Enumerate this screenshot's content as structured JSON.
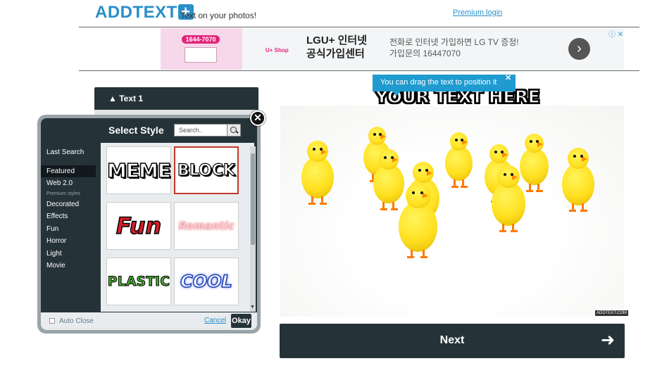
{
  "header": {
    "logo_text": "ADDTEXT",
    "logo_plus": "+",
    "tagline": "Text on your photos!",
    "premium_login": "Premium login"
  },
  "ad": {
    "phone": "1644-7070",
    "brand": "U+ Shop",
    "title_line1": "LGU+ 인터넷",
    "title_line2": "공식가입센터",
    "body_line1": "전화로 인터넷 가입하면 LG TV 증정!",
    "body_line2": "가입문의 16447070",
    "arrow_icon": "chevron-right-icon",
    "ad_choices": "ⓘ ✕"
  },
  "text_panel": {
    "label": "▲ Text 1"
  },
  "style_dialog": {
    "title": "Select Style",
    "search_placeholder": "Search..",
    "close_symbol": "✕",
    "categories": [
      {
        "label": "Last Search"
      },
      {
        "label": "Featured",
        "active": true
      },
      {
        "label": "Web 2.0"
      }
    ],
    "premium_section": "Premium styles",
    "premium_categories": [
      {
        "label": "Decorated"
      },
      {
        "label": "Effects"
      },
      {
        "label": "Fun"
      },
      {
        "label": "Horror"
      },
      {
        "label": "Light"
      },
      {
        "label": "Movie"
      }
    ],
    "styles": [
      {
        "label": "MEME"
      },
      {
        "label": "BLOCK",
        "selected": true
      },
      {
        "label": "Fun"
      },
      {
        "label": "Romantic"
      },
      {
        "label": "PLASTIC"
      },
      {
        "label": "COOL"
      }
    ],
    "auto_close": "Auto Close",
    "cancel": "Cancel",
    "okay": "Okay"
  },
  "editor": {
    "tooltip": "You can drag the text to position it",
    "tooltip_close": "✕",
    "overlay_text": "YOUR TEXT HERE",
    "watermark": "ADDTEXT.COM",
    "next_label": "Next",
    "next_arrow": "➜"
  },
  "colors": {
    "brand_blue": "#2a8fc9",
    "dark_panel": "#253339",
    "tooltip_blue": "#1f9bcf"
  }
}
